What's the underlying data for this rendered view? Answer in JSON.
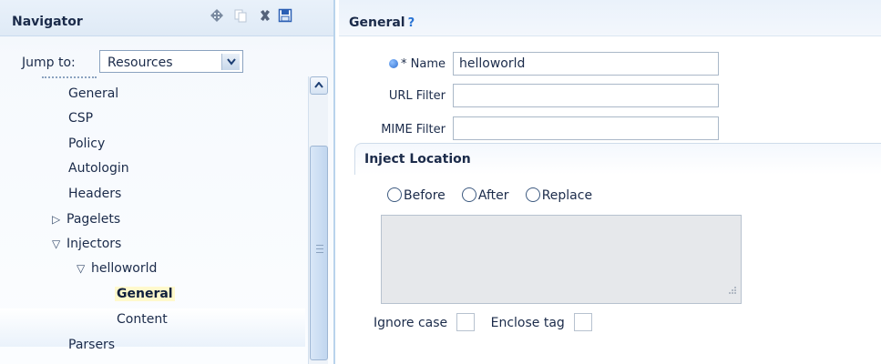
{
  "navigator": {
    "title": "Navigator",
    "toolbar": [
      {
        "name": "move-icon"
      },
      {
        "name": "copy-icon"
      },
      {
        "name": "delete-icon"
      },
      {
        "name": "save-icon"
      }
    ],
    "jump_to_label": "Jump to:",
    "jump_to_value": "Resources",
    "tree": [
      {
        "label": "General",
        "level": 1,
        "expander": ""
      },
      {
        "label": "CSP",
        "level": 1,
        "expander": ""
      },
      {
        "label": "Policy",
        "level": 1,
        "expander": ""
      },
      {
        "label": "Autologin",
        "level": 1,
        "expander": ""
      },
      {
        "label": "Headers",
        "level": 1,
        "expander": ""
      },
      {
        "label": "Pagelets",
        "level": 0,
        "expander": "▷"
      },
      {
        "label": "Injectors",
        "level": 0,
        "expander": "▽"
      },
      {
        "label": "helloworld",
        "level": 1,
        "expander": "▽"
      },
      {
        "label": "General",
        "level": 3,
        "expander": "",
        "selected": true
      },
      {
        "label": "Content",
        "level": 3,
        "expander": ""
      },
      {
        "label": "Parsers",
        "level": 1,
        "expander": ""
      }
    ]
  },
  "content": {
    "title": "General",
    "help_label": "?",
    "fields": {
      "name": {
        "label": "* Name",
        "value": "helloworld"
      },
      "url_filter": {
        "label": "URL Filter",
        "value": ""
      },
      "mime_filter": {
        "label": "MIME Filter",
        "value": ""
      }
    },
    "inject_location": {
      "title": "Inject Location",
      "options": [
        "Before",
        "After",
        "Replace"
      ]
    },
    "ignore_case_label": "Ignore case",
    "enclose_tag_label": "Enclose tag"
  }
}
